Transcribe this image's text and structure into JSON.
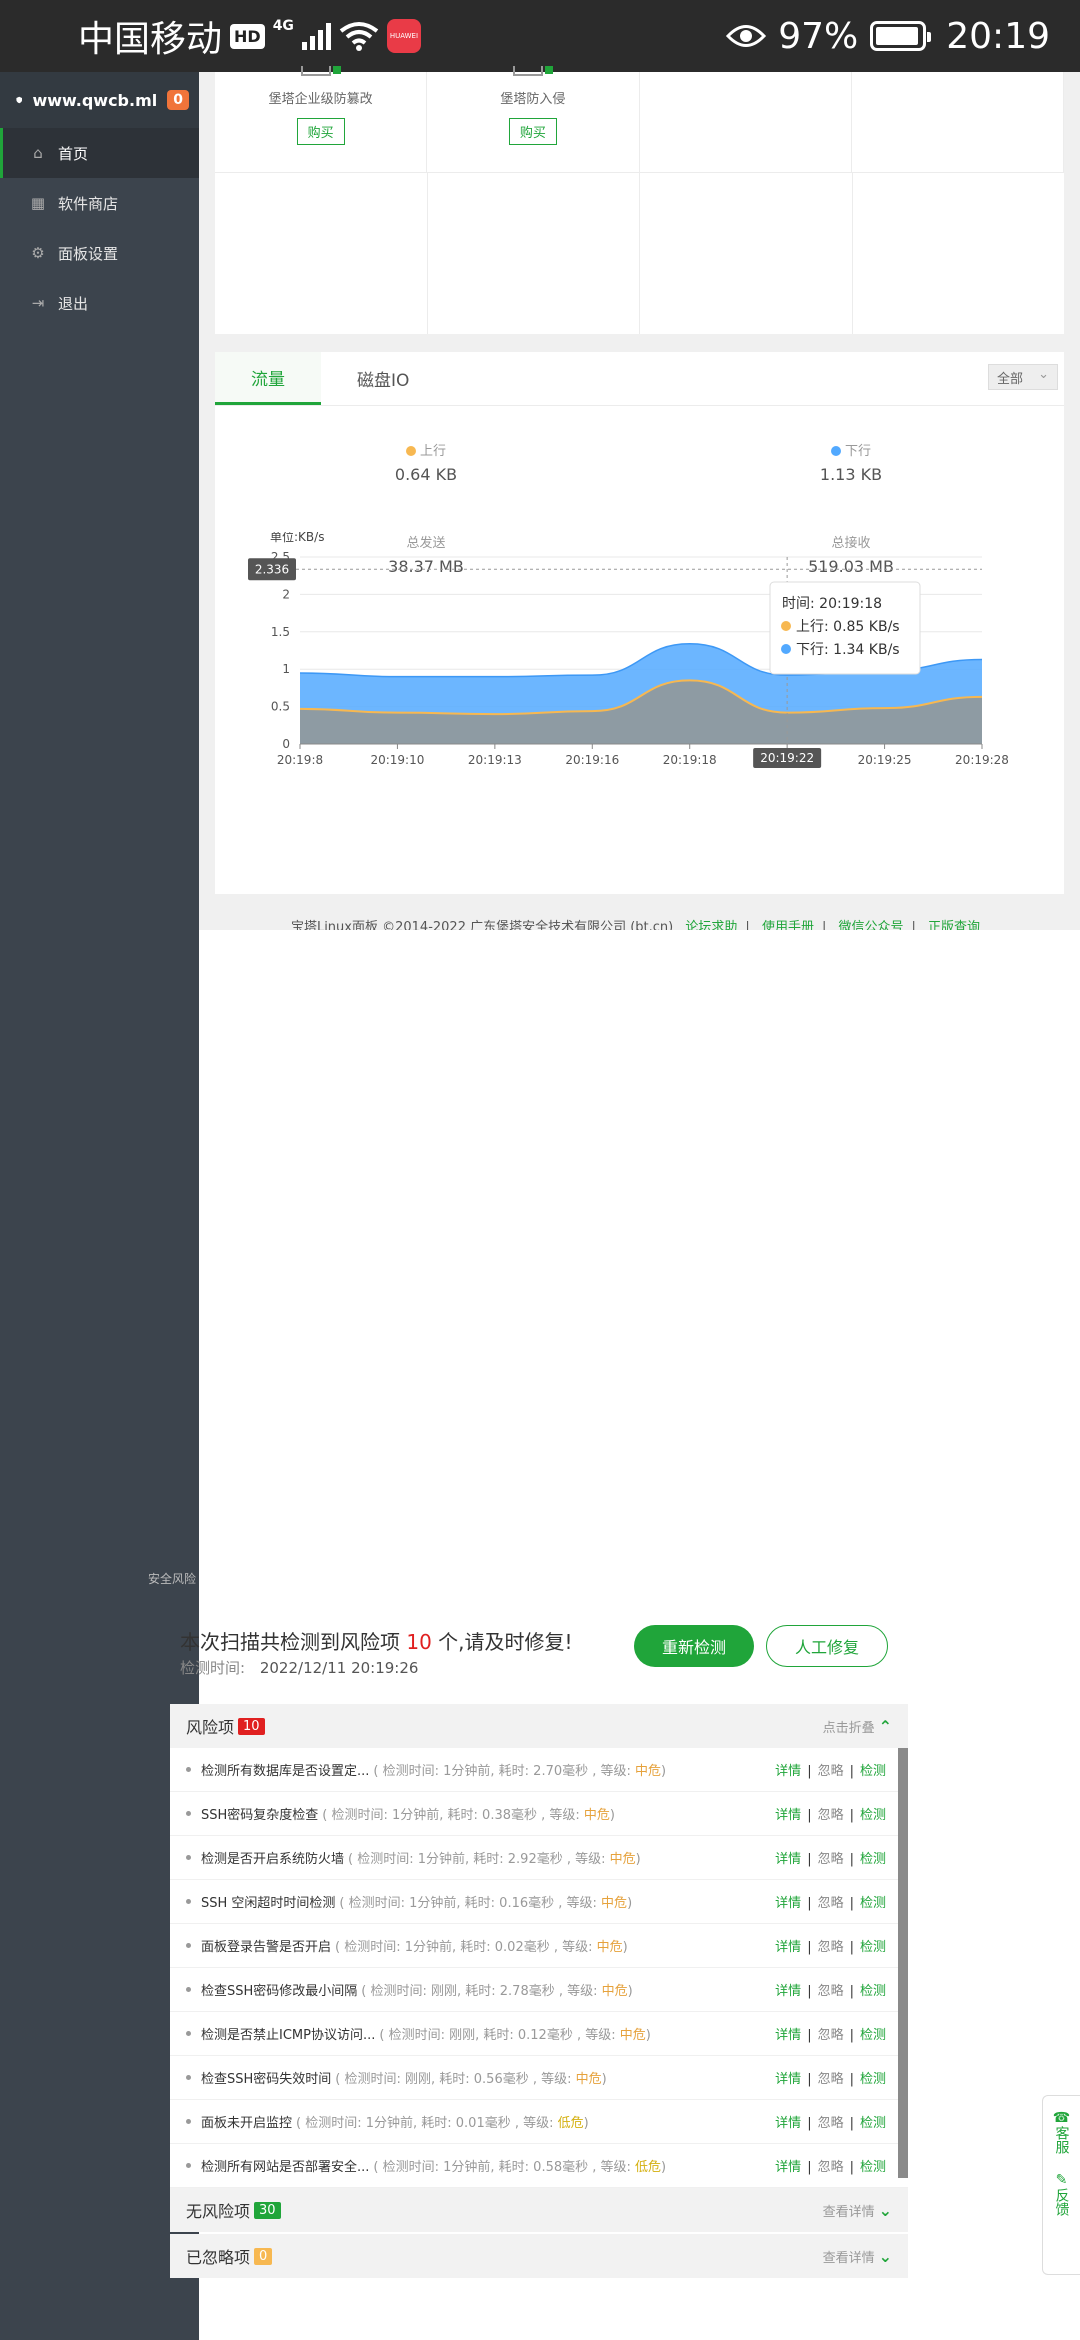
{
  "status_bar": {
    "carrier": "中国移动",
    "hd_badge": "HD",
    "net_type": "4G",
    "huawei_app": "HUAWEI",
    "battery": "97%",
    "time": "20:19"
  },
  "sidebar": {
    "site": "www.qwcb.ml",
    "count": "0",
    "items": [
      {
        "label": "首页",
        "icon": "home-icon"
      },
      {
        "label": "软件商店",
        "icon": "grid-icon"
      },
      {
        "label": "面板设置",
        "icon": "gear-icon"
      },
      {
        "label": "退出",
        "icon": "logout-icon"
      }
    ]
  },
  "soft": {
    "cells": [
      {
        "name": "堡塔企业级防篡改",
        "buy": "购买"
      },
      {
        "name": "堡塔防入侵",
        "buy": "购买"
      }
    ]
  },
  "net": {
    "tabs": [
      "流量",
      "磁盘IO"
    ],
    "select": "全部",
    "up_label": "上行",
    "up_value": "0.64 KB",
    "down_label": "下行",
    "down_value": "1.13 KB",
    "sent_label": "总发送",
    "sent_value": "38.37 MB",
    "recv_label": "总接收",
    "recv_value": "519.03 MB"
  },
  "chart_data": {
    "type": "area",
    "ylabel": "单位:KB/s",
    "ylim": [
      0,
      2.5
    ],
    "yticks": [
      "0",
      "0.5",
      "1",
      "1.5",
      "2",
      "2.5"
    ],
    "categories": [
      "20:19:8",
      "20:19:10",
      "20:19:13",
      "20:19:16",
      "20:19:18",
      "20:19:22",
      "20:19:25",
      "20:19:28"
    ],
    "series": [
      {
        "name": "上行",
        "color": "#f7b851",
        "values": [
          0.47,
          0.42,
          0.4,
          0.44,
          0.85,
          0.42,
          0.48,
          0.63
        ]
      },
      {
        "name": "下行",
        "color": "#52a9ff",
        "values": [
          0.95,
          0.9,
          0.9,
          0.92,
          1.34,
          0.92,
          0.98,
          1.13
        ]
      }
    ],
    "crosshair": {
      "y_label": "2.336",
      "x_label": "20:19:22"
    },
    "tooltip": {
      "time_label": "时间:",
      "time": "20:19:18",
      "up": "上行:",
      "up_value": "0.85 KB/s",
      "down": "下行:",
      "down_value": "1.34 KB/s"
    }
  },
  "footer": {
    "copyright": "宝塔Linux面板 ©2014-2022 广东堡塔安全技术有限公司 (bt.cn)",
    "links": [
      "论坛求助",
      "使用手册",
      "微信公众号",
      "正版查询"
    ]
  },
  "scan": {
    "ghost_title": "安全风险",
    "headline_a": "本次扫描共检测到风险项",
    "headline_num": "10",
    "headline_b": "个,请及时修复!",
    "time_label": "检测时间:",
    "time_value": "2022/12/11 20:19:26",
    "rescan": "重新检测",
    "manual": "人工修复"
  },
  "risk": {
    "title": "风险项",
    "count": "10",
    "toggle": "点击折叠",
    "rows": [
      {
        "name": "检测所有数据库是否设置定...",
        "meta": "( 检测时间: 1分钟前, 耗时: 2.70毫秒 , 等级: ",
        "level": "中危",
        "lvl": "mid"
      },
      {
        "name": "SSH密码复杂度检查",
        "meta": "( 检测时间: 1分钟前, 耗时: 0.38毫秒 , 等级: ",
        "level": "中危",
        "lvl": "mid"
      },
      {
        "name": "检测是否开启系统防火墙",
        "meta": "( 检测时间: 1分钟前, 耗时: 2.92毫秒 , 等级: ",
        "level": "中危",
        "lvl": "mid"
      },
      {
        "name": "SSH 空闲超时时间检测",
        "meta": "( 检测时间: 1分钟前, 耗时: 0.16毫秒 , 等级: ",
        "level": "中危",
        "lvl": "mid"
      },
      {
        "name": "面板登录告警是否开启",
        "meta": "( 检测时间: 1分钟前, 耗时: 0.02毫秒 , 等级: ",
        "level": "中危",
        "lvl": "mid"
      },
      {
        "name": "检查SSH密码修改最小间隔",
        "meta": "( 检测时间: 刚刚, 耗时: 2.78毫秒 , 等级: ",
        "level": "中危",
        "lvl": "mid"
      },
      {
        "name": "检测是否禁止ICMP协议访问...",
        "meta": "( 检测时间: 刚刚, 耗时: 0.12毫秒 , 等级: ",
        "level": "中危",
        "lvl": "mid"
      },
      {
        "name": "检查SSH密码失效时间",
        "meta": "( 检测时间: 刚刚, 耗时: 0.56毫秒 , 等级: ",
        "level": "中危",
        "lvl": "mid"
      },
      {
        "name": "面板未开启监控",
        "meta": "( 检测时间: 1分钟前, 耗时: 0.01毫秒 , 等级: ",
        "level": "低危",
        "lvl": "low"
      },
      {
        "name": "检测所有网站是否部署安全...",
        "meta": "( 检测时间: 1分钟前, 耗时: 0.58毫秒 , 等级: ",
        "level": "低危",
        "lvl": "low"
      }
    ],
    "actions": {
      "detail": "详情",
      "ignore": "忽略",
      "check": "检测",
      "sep": "|"
    }
  },
  "no_risk": {
    "title": "无风险项",
    "count": "30",
    "toggle": "查看详情"
  },
  "ignored": {
    "title": "已忽略项",
    "count": "0",
    "toggle": "查看详情"
  },
  "float": {
    "service": "客服",
    "feedback": "反馈"
  },
  "colors": {
    "accent": "#20a53a",
    "danger": "#e02020",
    "warn": "#e6a23c",
    "sidebar": "#3c444d"
  }
}
